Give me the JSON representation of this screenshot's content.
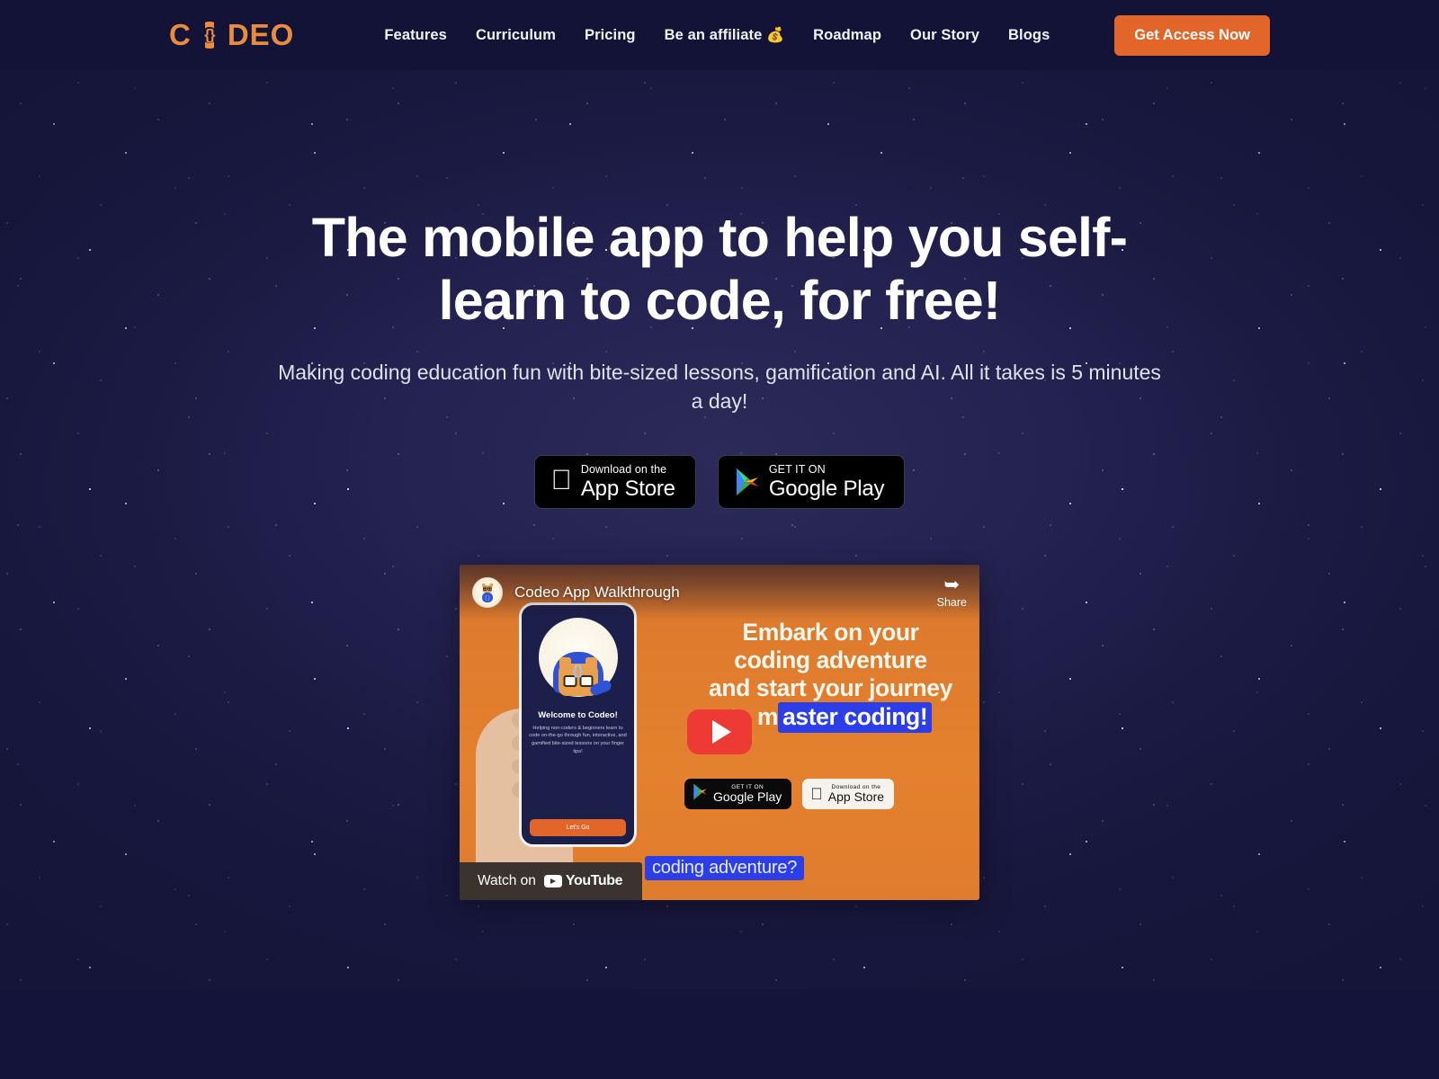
{
  "header": {
    "logo_text": "CODEO",
    "logo_braces": "{}",
    "nav": [
      {
        "label": "Features",
        "icon": ""
      },
      {
        "label": "Curriculum",
        "icon": ""
      },
      {
        "label": "Pricing",
        "icon": ""
      },
      {
        "label": "Be an affiliate",
        "icon": "💰"
      },
      {
        "label": "Roadmap",
        "icon": ""
      },
      {
        "label": "Our Story",
        "icon": ""
      },
      {
        "label": "Blogs",
        "icon": ""
      }
    ],
    "cta_label": "Get Access Now"
  },
  "hero": {
    "headline": "The mobile app to help you self-learn to code, for free!",
    "subhead": "Making coding education fun with bite-sized lessons, gamification and AI. All it takes is 5 minutes a day!",
    "badges": [
      {
        "small": "Download on the",
        "big": "App Store",
        "icon": "apple-icon"
      },
      {
        "small": "GET IT ON",
        "big": "Google Play",
        "icon": "google-play-icon"
      }
    ]
  },
  "video": {
    "title": "Codeo App Walkthrough",
    "share_label": "Share",
    "share_icon": "share-arrow-icon",
    "play_icon": "play-icon",
    "watch_on_label": "Watch on",
    "youtube_word": "YouTube",
    "headline_line1": "Embark on your",
    "headline_line2": "coding adventure",
    "headline_line3": "and start your journey",
    "headline_line4_plain": "to m",
    "headline_line4_highlight": "aster coding!",
    "caption": "coding adventure?",
    "badges": [
      {
        "small": "GET IT ON",
        "big": "Google Play",
        "icon": "google-play-icon"
      },
      {
        "small": "Download on the",
        "big": "App Store",
        "icon": "apple-icon"
      }
    ],
    "phone": {
      "heading": "Welcome to Codeo!",
      "body": "Helping non-coders & beginners learn to code on-the-go through fun, interactive, and gamified bite-sized lessons on your finger tips!",
      "button_label": "Let's Go",
      "mascot_braces": "{}"
    }
  },
  "colors": {
    "brand_orange": "#e2652a",
    "logo_orange": "#e98c3e",
    "header_bg": "#131337",
    "page_bg": "#141339",
    "video_orange": "#e4812f",
    "highlight_blue": "#2b3ee8",
    "youtube_red": "#ee3a35"
  }
}
